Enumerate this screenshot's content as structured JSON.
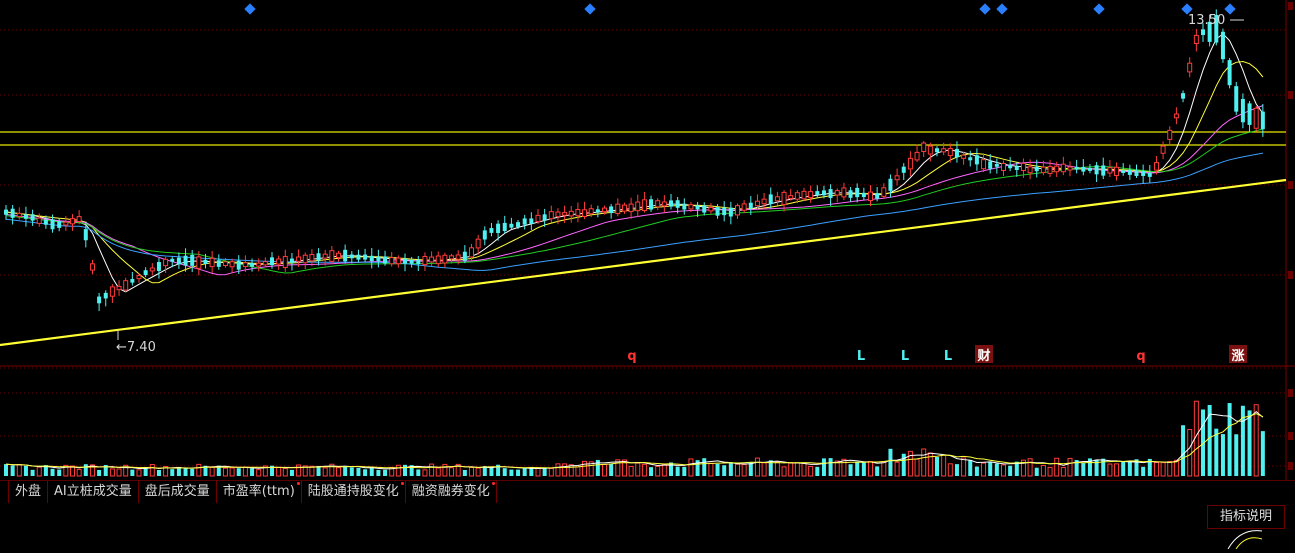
{
  "chart_data": {
    "type": "candlestick",
    "price_markers": {
      "high_label": "13.50",
      "low_label": "←7.40"
    },
    "event_markers": [
      "q",
      "L",
      "L",
      "L",
      "财",
      "q",
      "涨"
    ],
    "colors": {
      "up": "#ff3b3b",
      "down": "#4ef0f0",
      "ma5": "#ffffff",
      "ma10": "#ffff3c",
      "ma20": "#ff66ff",
      "ma30": "#22cc22",
      "ma60": "#3aa0ff",
      "trendline": "#ffff33",
      "event_marker": "#ff3333",
      "diamond_marker": "#2a7fff"
    }
  },
  "bottom_tabs": [
    {
      "label": "外盘",
      "dot": false
    },
    {
      "label": "AI立桩成交量",
      "dot": false
    },
    {
      "label": "盘后成交量",
      "dot": false
    },
    {
      "label": "市盈率(ttm)",
      "dot": true
    },
    {
      "label": "陆股通持股变化",
      "dot": true
    },
    {
      "label": "融资融券变化",
      "dot": true
    }
  ],
  "help_button_label": "指标说明"
}
